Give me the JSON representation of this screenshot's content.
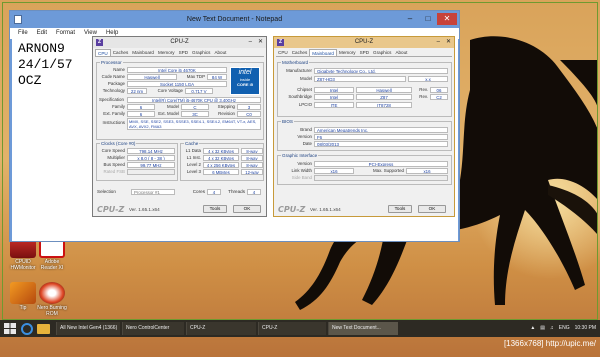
{
  "notepad": {
    "title": "New Text Document - Notepad",
    "menu": [
      "File",
      "Edit",
      "Format",
      "View",
      "Help"
    ],
    "text": "ARNON9\n24/1/57\nOCZ"
  },
  "cpuz1": {
    "title": "CPU-Z",
    "tabs": [
      "CPU",
      "Caches",
      "Mainboard",
      "Memory",
      "SPD",
      "Graphics",
      "About"
    ],
    "active_tab": "CPU",
    "processor": {
      "group": "Processor",
      "name_l": "Name",
      "name": "Intel Core i5 4670K",
      "code_l": "Code Name",
      "code": "Haswell",
      "tdp_l": "Max TDP",
      "tdp": "84 W",
      "pkg_l": "Package",
      "pkg": "Socket 1150 LGA",
      "tech_l": "Technology",
      "tech": "22 nm",
      "cvolt_l": "Core Voltage",
      "cvolt": "0.717 V",
      "spec_l": "Specification",
      "spec": "Intel(R) Core(TM) i5-4670K CPU @ 3.40GHz",
      "fam_l": "Family",
      "fam": "6",
      "model_l": "Model",
      "model": "C",
      "step_l": "Stepping",
      "step": "3",
      "efam_l": "Ext. Family",
      "efam": "6",
      "emodel_l": "Ext. Model",
      "emodel": "3C",
      "rev_l": "Revision",
      "rev": "C0",
      "instr_l": "Instructions",
      "instr": "MMX, SSE, SSE2, SSE3, SSSE3, SSE4.1, SSE4.2, EM64T, VT-x, AES, AVX, AVX2, FMA3",
      "logo_brand": "intel",
      "logo_inside": "inside",
      "logo_core": "CORE i5"
    },
    "clocks": {
      "group": "Clocks (Core #0)",
      "cs_l": "Core Speed",
      "cs": "798.14 MHz",
      "mul_l": "Multiplier",
      "mul": "x 8.0 ( 8 - 38 )",
      "bus_l": "Bus Speed",
      "bus": "99.77 MHz",
      "fsb_l": "Rated FSB",
      "fsb": ""
    },
    "cache": {
      "group": "Cache",
      "l1d_l": "L1 Data",
      "l1d": "4 x 32 KBytes",
      "l1d_w": "8-way",
      "l1i_l": "L1 Inst.",
      "l1i": "4 x 32 KBytes",
      "l1i_w": "8-way",
      "l2_l": "Level 2",
      "l2": "4 x 256 KBytes",
      "l2_w": "8-way",
      "l3_l": "Level 3",
      "l3": "6 MBytes",
      "l3_w": "12-way"
    },
    "sel_l": "Selection",
    "sel": "Processor #1",
    "cores_l": "Cores",
    "cores": "4",
    "threads_l": "Threads",
    "threads": "4",
    "brand": "CPU-Z",
    "version": "Ver. 1.65.1.x64",
    "tools": "Tools",
    "ok": "OK"
  },
  "cpuz2": {
    "title": "CPU-Z",
    "tabs": [
      "CPU",
      "Caches",
      "Mainboard",
      "Memory",
      "SPD",
      "Graphics",
      "About"
    ],
    "active_tab": "Mainboard",
    "mb": {
      "group": "Motherboard",
      "manu_l": "Manufacturer",
      "manu": "Gigabyte Technology Co., Ltd.",
      "model_l": "Model",
      "model": "Z87-HD3",
      "model_r": "x.x",
      "chip_l": "Chipset",
      "chip_a": "Intel",
      "chip_b": "Haswell",
      "chip_rev_l": "Rev.",
      "chip_rev": "06",
      "sb_l": "Southbridge",
      "sb_a": "Intel",
      "sb_b": "Z87",
      "sb_rev_l": "Rev.",
      "sb_rev": "C2",
      "lpc_l": "LPCIO",
      "lpc_a": "ITE",
      "lpc_b": "IT8728"
    },
    "bios": {
      "group": "BIOS",
      "brand_l": "Brand",
      "brand": "American Megatrends Inc.",
      "ver_l": "Version",
      "ver": "F6",
      "date_l": "Date",
      "date": "08/03/2013"
    },
    "gi": {
      "group": "Graphic Interface",
      "ver_l": "Version",
      "ver": "PCI-Express",
      "lw_l": "Link Width",
      "lw": "x16",
      "ms_l": "Max. Supported",
      "ms": "x16",
      "sb_l": "Side Band",
      "sb": ""
    },
    "brand": "CPU-Z",
    "version": "Ver. 1.65.1.x64",
    "tools": "Tools",
    "ok": "OK"
  },
  "desktop": {
    "icons": [
      {
        "label": "CPUID HWMonitor"
      },
      {
        "label": "Adobe Reader XI"
      },
      {
        "label": "Tip"
      },
      {
        "label": "Nero Burning ROM"
      }
    ]
  },
  "taskbar": {
    "items": [
      "All New Intel Gen4 (1366)",
      "Nero ControlCenter",
      "CPU-Z",
      "CPU-Z",
      "New Text Document..."
    ],
    "lang": "ENG",
    "time": "10:30 PM"
  },
  "watermark": "[1366x768] http://upic.me/",
  "colors": {
    "taskbar": "#2d2a23",
    "notepad_title": "#6d9ad8",
    "cpuz2_title": "#e9c78b",
    "intel_blue": "#1160b0"
  }
}
